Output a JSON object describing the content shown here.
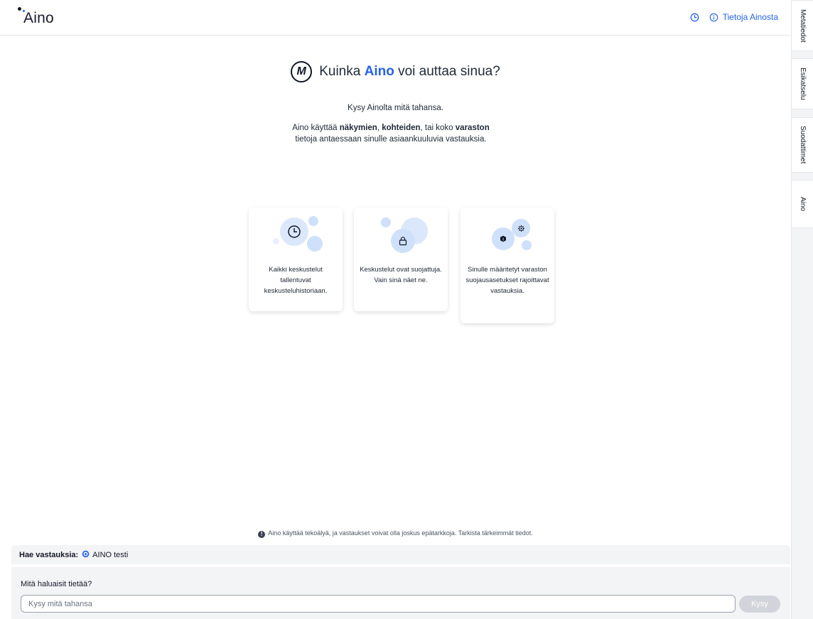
{
  "app": {
    "logo_text": "Aino"
  },
  "header": {
    "history_icon": "clock-icon",
    "about_label": "Tietoja Ainosta",
    "about_icon": "info-icon"
  },
  "sidetabs": [
    {
      "label": "Metatiedot"
    },
    {
      "label": "Esikatselu"
    },
    {
      "label": "Suodattimet"
    },
    {
      "label": "Aino"
    }
  ],
  "welcome": {
    "badge_letter": "M",
    "title_prefix": "Kuinka",
    "title_brand": "Aino",
    "title_suffix": "voi auttaa sinua?",
    "subtitle": "Kysy Ainolta mitä tahansa.",
    "desc_1": "Aino käyttää",
    "desc_b1": "näkymien",
    "desc_2": ",",
    "desc_b2": "kohteiden",
    "desc_3": ", tai koko",
    "desc_b3": "varaston",
    "desc_4": "tietoja antaessaan sinulle asiaankuuluvia vastauksia."
  },
  "cards": [
    {
      "icon": "clock-icon",
      "text": "Kaikki keskustelut tallentuvat keskusteluhistoriaan."
    },
    {
      "icon": "lock-icon",
      "text": "Keskustelut ovat suojattuja. Vain sinä näet ne."
    },
    {
      "icon": "shield-cube-icon",
      "text": "Sinulle määritetyt varaston suojausasetukset rajoittavat vastauksia."
    }
  ],
  "disclaimer": {
    "icon": "info-filled-icon",
    "text": "Aino käyttää tekoälyä, ja vastaukset voivat olla joskus epätarkkoja. Tarkista tärkeimmät tiedot."
  },
  "source": {
    "label": "Hae vastauksia:",
    "icon": "database-icon",
    "value": "AINO testi"
  },
  "ask": {
    "label": "Mitä haluaisit tietää?",
    "placeholder": "Kysy mitä tahansa",
    "button_label": "Kysy"
  }
}
